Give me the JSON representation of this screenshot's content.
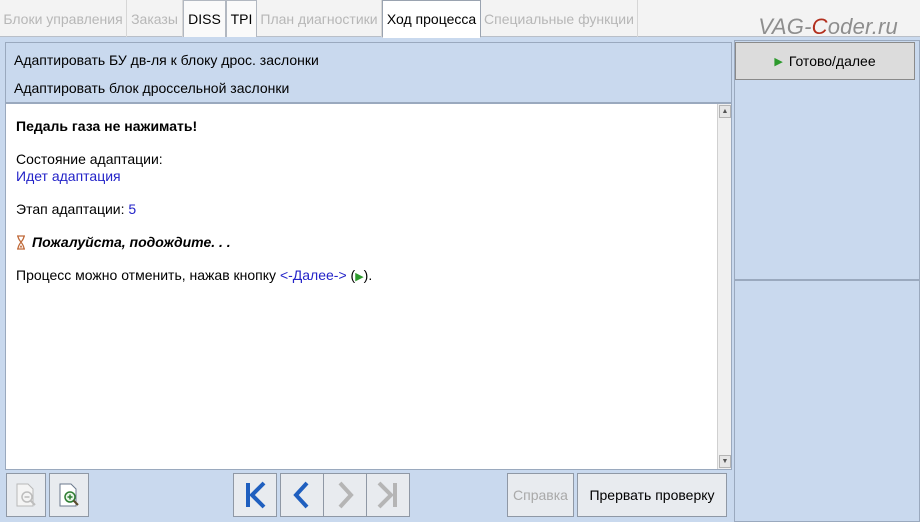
{
  "tabs": [
    {
      "label": "Блоки управления",
      "state": "disabled"
    },
    {
      "label": "Заказы",
      "state": "disabled"
    },
    {
      "label": "DISS",
      "state": "enabled"
    },
    {
      "label": "TPI",
      "state": "enabled"
    },
    {
      "label": "План диагностики",
      "state": "disabled"
    },
    {
      "label": "Ход процесса",
      "state": "selected"
    },
    {
      "label": "Специальные функции",
      "state": "disabled"
    }
  ],
  "watermark": {
    "prefix": "VAG-",
    "highlight": "C",
    "suffix": "oder.ru"
  },
  "header": {
    "line1": "Адаптировать БУ дв-ля к блоку дрос. заслонки",
    "line2": "Адаптировать блок дроссельной заслонки"
  },
  "content": {
    "warning": "Педаль газа не нажимать!",
    "status_label": "Состояние адаптации:",
    "status_value": "Идет адаптация",
    "stage_label": "Этап адаптации: ",
    "stage_value": "5",
    "wait_text": "Пожалуйста, подождите. . .",
    "cancel_prefix": "Процесс можно отменить, нажав кнопку ",
    "cancel_link": "<-Далее->",
    "cancel_open": " (",
    "cancel_close": ")."
  },
  "toolbar": {
    "help_label": "Справка",
    "abort_label": "Прервать проверку"
  },
  "right_panel": {
    "next_label": "Готово/далее"
  },
  "colors": {
    "panel_bg": "#c9d9ee",
    "nav_blue": "#1f5fbf",
    "link_blue": "#2323c8",
    "accent_green": "#2d9a2d"
  }
}
